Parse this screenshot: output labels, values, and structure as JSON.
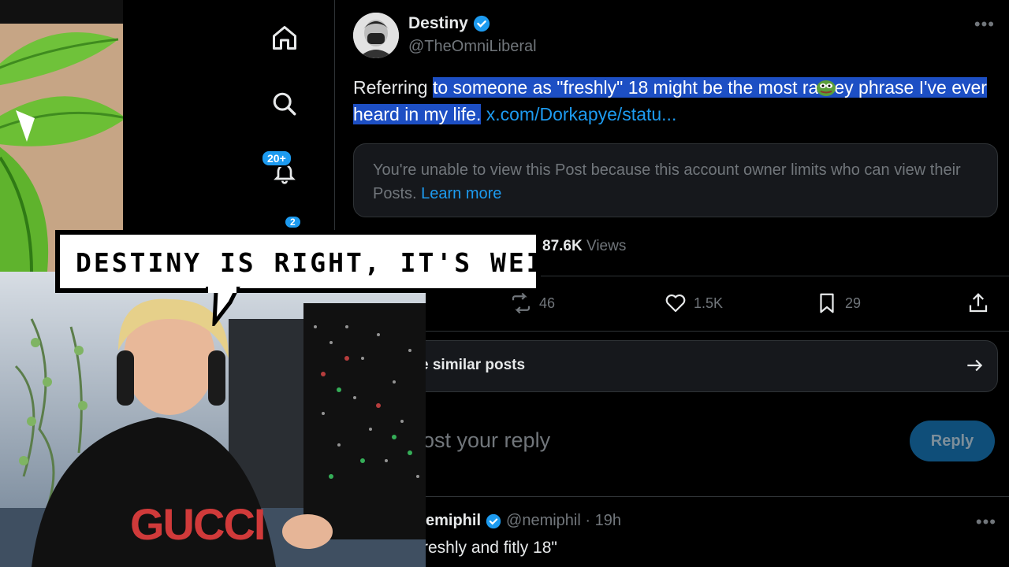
{
  "author": {
    "name": "Destiny",
    "handle": "@TheOmniLiberal"
  },
  "tweet": {
    "text_before": "Referring ",
    "text_highlighted_1": "to someone as \"freshly\" 18 might be the most ra",
    "text_highlighted_2": "ey phrase I've ever heard in my life.",
    "link": "x.com/Dorkapye/statu..."
  },
  "quote": {
    "message": "You're unable to view this Post because this account owner limits who can view their Posts.",
    "learn_more": "Learn more"
  },
  "stats": {
    "views_count": "87.6K",
    "views_label": "Views",
    "retweets": "46",
    "likes": "1.5K",
    "bookmarks": "29"
  },
  "nav": {
    "notifications_badge": "20+",
    "messages_badge": "2"
  },
  "similar": {
    "label": "e similar posts"
  },
  "reply": {
    "placeholder": "ost your reply",
    "button": "Reply"
  },
  "comment": {
    "name": "emiphil",
    "handle_time": "@nemiphil · 19h",
    "text": "reshly and fitly 18\""
  },
  "overlay": {
    "caption": "DESTINY IS RIGHT, IT'S WEIRD",
    "shirt_text": "GUCCI"
  },
  "colors": {
    "accent": "#1d9bf0",
    "highlight": "#1d4fc4",
    "muted": "#71767b"
  }
}
